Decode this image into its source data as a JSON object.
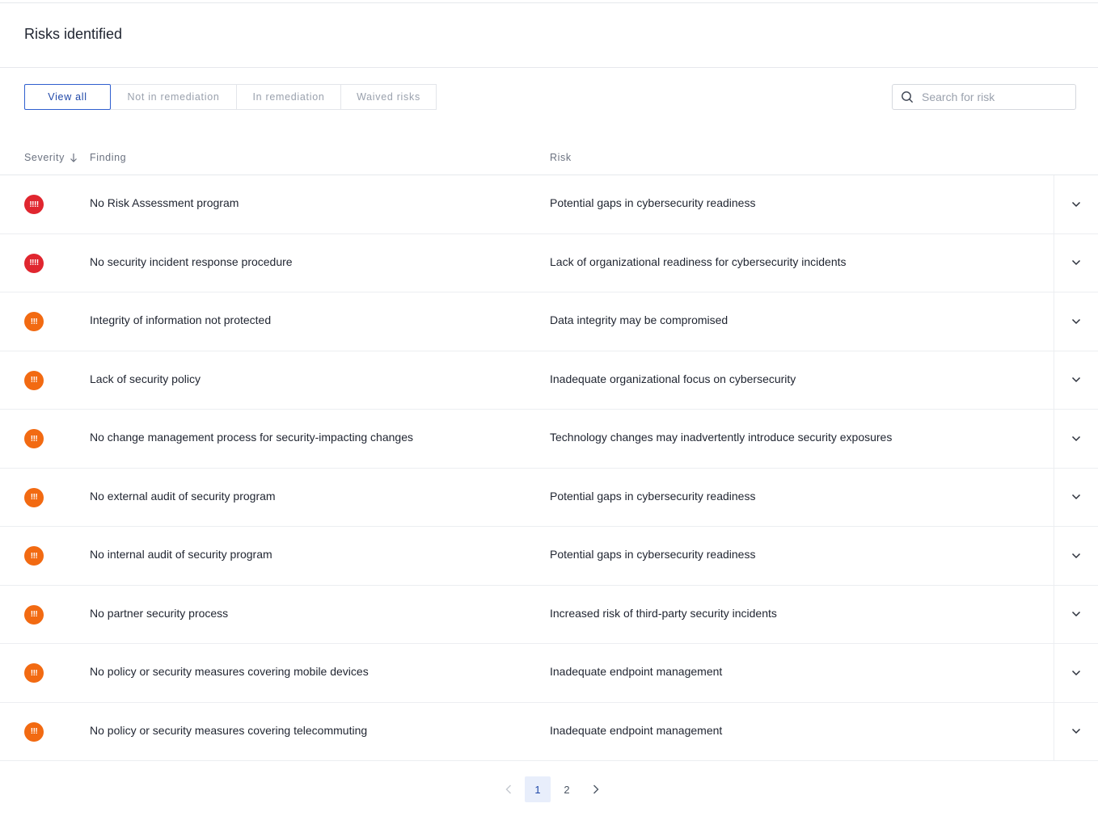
{
  "header": {
    "title": "Risks identified"
  },
  "filters": [
    {
      "label": "View all",
      "active": true
    },
    {
      "label": "Not in remediation",
      "active": false
    },
    {
      "label": "In remediation",
      "active": false
    },
    {
      "label": "Waived risks",
      "active": false
    }
  ],
  "search": {
    "placeholder": "Search for risk",
    "value": ""
  },
  "table": {
    "columns": {
      "severity": "Severity",
      "finding": "Finding",
      "risk": "Risk"
    },
    "rows": [
      {
        "severity": "critical",
        "severity_glyph": "!!!!",
        "finding": "No Risk Assessment program",
        "risk": "Potential gaps in cybersecurity readiness"
      },
      {
        "severity": "critical",
        "severity_glyph": "!!!!",
        "finding": "No security incident response procedure",
        "risk": "Lack of organizational readiness for cybersecurity incidents"
      },
      {
        "severity": "high",
        "severity_glyph": "!!!",
        "finding": "Integrity of information not protected",
        "risk": "Data integrity may be compromised"
      },
      {
        "severity": "high",
        "severity_glyph": "!!!",
        "finding": "Lack of security policy",
        "risk": "Inadequate organizational focus on cybersecurity"
      },
      {
        "severity": "high",
        "severity_glyph": "!!!",
        "finding": "No change management process for security-impacting changes",
        "risk": "Technology changes may inadvertently introduce security exposures"
      },
      {
        "severity": "high",
        "severity_glyph": "!!!",
        "finding": "No external audit of security program",
        "risk": "Potential gaps in cybersecurity readiness"
      },
      {
        "severity": "high",
        "severity_glyph": "!!!",
        "finding": "No internal audit of security program",
        "risk": "Potential gaps in cybersecurity readiness"
      },
      {
        "severity": "high",
        "severity_glyph": "!!!",
        "finding": "No partner security process",
        "risk": "Increased risk of third-party security incidents"
      },
      {
        "severity": "high",
        "severity_glyph": "!!!",
        "finding": "No policy or security measures covering mobile devices",
        "risk": "Inadequate endpoint management"
      },
      {
        "severity": "high",
        "severity_glyph": "!!!",
        "finding": "No policy or security measures covering telecommuting",
        "risk": "Inadequate endpoint management"
      }
    ]
  },
  "pagination": {
    "pages": [
      "1",
      "2"
    ],
    "current": "1"
  },
  "colors": {
    "critical": "#e0262f",
    "high": "#f26a12",
    "accent": "#2f5fcf"
  },
  "icons": {
    "search": "search-icon",
    "sort": "arrow-down-icon",
    "expand": "chevron-down-icon",
    "prev": "chevron-left-icon",
    "next": "chevron-right-icon"
  }
}
